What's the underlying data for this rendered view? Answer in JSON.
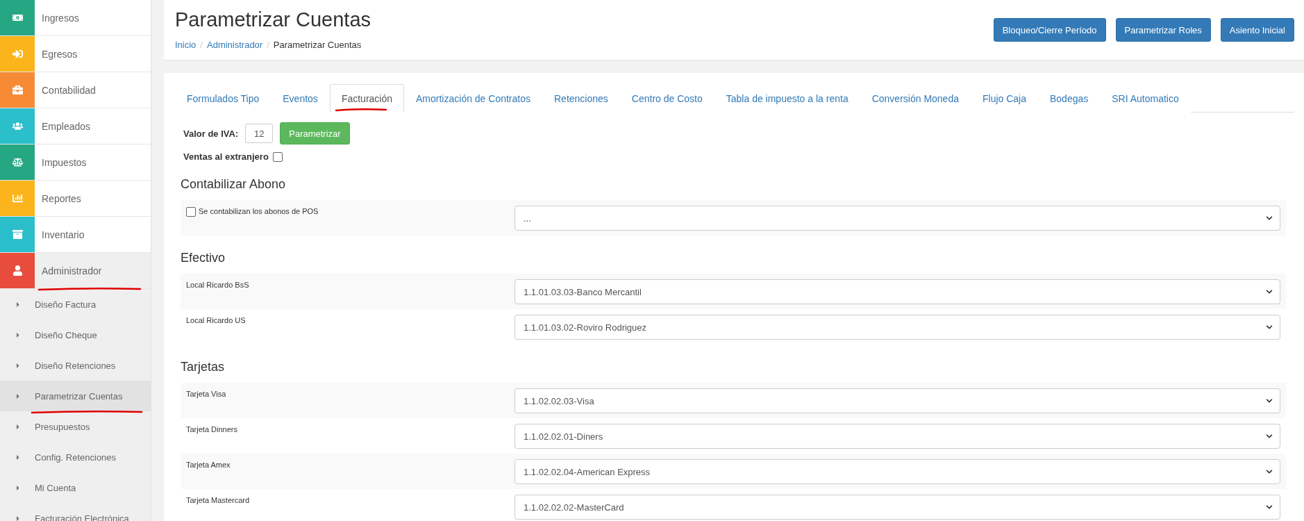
{
  "sidebar": {
    "modules": [
      {
        "label": "Ingresos",
        "color": "#26a783",
        "selected": false
      },
      {
        "label": "Egresos",
        "color": "#fbb41b",
        "selected": false
      },
      {
        "label": "Contabilidad",
        "color": "#f78b35",
        "selected": false
      },
      {
        "label": "Empleados",
        "color": "#2bbecb",
        "selected": false
      },
      {
        "label": "Impuestos",
        "color": "#26a783",
        "selected": false
      },
      {
        "label": "Reportes",
        "color": "#fbb41b",
        "selected": false
      },
      {
        "label": "Inventario",
        "color": "#2bbecb",
        "selected": false
      },
      {
        "label": "Administrador",
        "color": "#e84c3d",
        "selected": true,
        "children": [
          {
            "label": "Diseño Factura",
            "selected": false
          },
          {
            "label": "Diseño Cheque",
            "selected": false
          },
          {
            "label": "Diseño Retenciones",
            "selected": false
          },
          {
            "label": "Parametrizar Cuentas",
            "selected": true
          },
          {
            "label": "Presupuestos",
            "selected": false
          },
          {
            "label": "Config. Retenciones",
            "selected": false
          },
          {
            "label": "Mi Cuenta",
            "selected": false
          },
          {
            "label": "Facturación Electrónica",
            "selected": false
          }
        ]
      }
    ]
  },
  "header": {
    "title": "Parametrizar Cuentas",
    "breadcrumb": [
      "Inicio",
      "Administrador",
      "Parametrizar Cuentas"
    ],
    "breadcrumb_separator": "/",
    "buttons": [
      "Bloqueo/Cierre Período",
      "Parametrizar Roles",
      "Asiento Inicial"
    ]
  },
  "tabs": [
    {
      "label": "Formulados Tipo",
      "selected": false
    },
    {
      "label": "Eventos",
      "selected": false
    },
    {
      "label": "Facturación",
      "selected": true
    },
    {
      "label": "Amortización de Contratos",
      "selected": false
    },
    {
      "label": "Retenciones",
      "selected": false
    },
    {
      "label": "Centro de Costo",
      "selected": false
    },
    {
      "label": "Tabla de impuesto a la renta",
      "selected": false
    },
    {
      "label": "Conversión Moneda",
      "selected": false
    },
    {
      "label": "Flujo Caja",
      "selected": false
    },
    {
      "label": "Bodegas",
      "selected": false
    },
    {
      "label": "SRI Automatico",
      "selected": false
    }
  ],
  "iva": {
    "label": "Valor de IVA:",
    "value": "12",
    "button": "Parametrizar"
  },
  "foreign_sales": {
    "label": "Ventas al extranjero",
    "checked": false
  },
  "sections": [
    {
      "title": "Contabilizar Abono",
      "rows": [
        {
          "kind": "checkbox",
          "label": "Se contabilizan los abonos de POS",
          "checked": false,
          "value": "..."
        }
      ]
    },
    {
      "title": "Efectivo",
      "rows": [
        {
          "kind": "plain",
          "label": "Local Ricardo BsS",
          "value": "1.1.01.03.03-Banco Mercantil"
        },
        {
          "kind": "plain",
          "label": "Local Ricardo US",
          "value": "1.1.01.03.02-Roviro Rodriguez"
        }
      ]
    },
    {
      "title": "Tarjetas",
      "rows": [
        {
          "kind": "plain",
          "label": "Tarjeta Visa",
          "value": "1.1.02.02.03-Visa"
        },
        {
          "kind": "plain",
          "label": "Tarjeta Dinners",
          "value": "1.1.02.02.01-Diners"
        },
        {
          "kind": "plain",
          "label": "Tarjeta Amex",
          "value": "1.1.02.02.04-American Express"
        },
        {
          "kind": "plain",
          "label": "Tarjeta Mastercard",
          "value": "1.1.02.02.02-MasterCard"
        }
      ]
    }
  ]
}
